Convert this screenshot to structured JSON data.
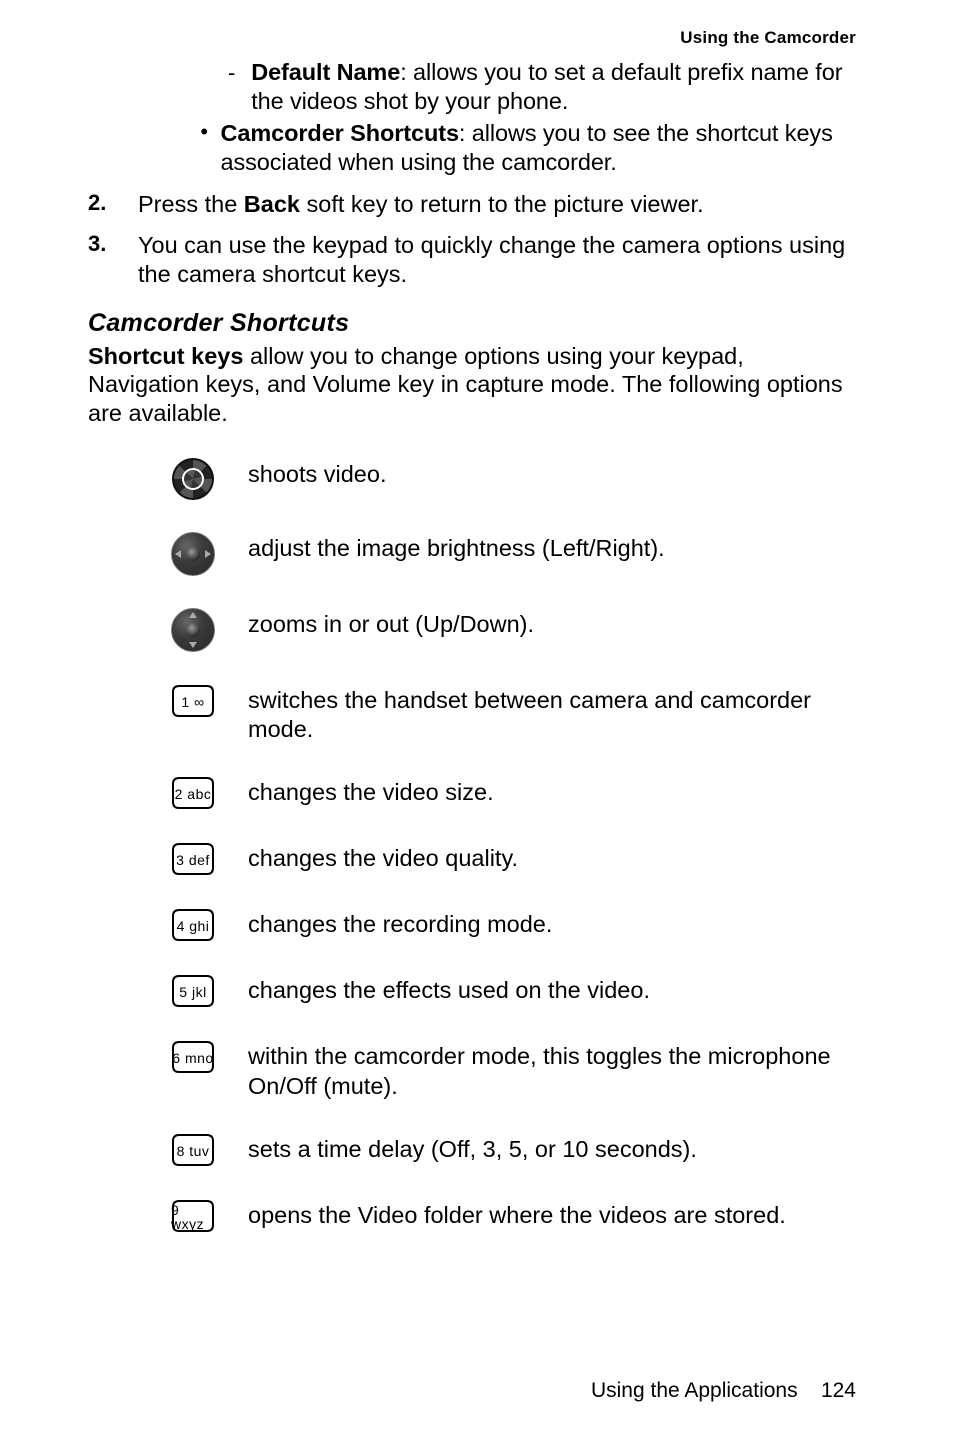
{
  "header": {
    "section_title": "Using the Camcorder"
  },
  "nested": {
    "default_name": {
      "label": "Default Name",
      "text": ": allows you to set a default prefix name for the videos shot by your phone."
    },
    "camcorder_shortcuts": {
      "label": "Camcorder Shortcuts",
      "text": ": allows you to see the shortcut keys associated when using the camcorder."
    }
  },
  "steps": {
    "s2": {
      "num": "2.",
      "pre": "Press the ",
      "bold": "Back",
      "post": " soft key to return to the picture viewer."
    },
    "s3": {
      "num": "3.",
      "text": "You can use the keypad to quickly change the camera options using the camera shortcut keys."
    }
  },
  "heading": "Camcorder Shortcuts",
  "intro": {
    "bold": "Shortcut keys",
    "rest": " allow you to change options using your keypad, Navigation keys, and Volume key in capture mode. The following options are available."
  },
  "shortcuts": [
    {
      "icon": "lens",
      "label": "",
      "desc": "shoots video."
    },
    {
      "icon": "nav-lr",
      "label": "",
      "desc": "adjust the image brightness (Left/Right)."
    },
    {
      "icon": "nav-ud",
      "label": "",
      "desc": "zooms in or out (Up/Down)."
    },
    {
      "icon": "key",
      "label": "1 ∞",
      "desc": "switches the handset between camera and camcorder mode."
    },
    {
      "icon": "key",
      "label": "2 abc",
      "desc": "changes the video size."
    },
    {
      "icon": "key",
      "label": "3 def",
      "desc": "changes the video quality."
    },
    {
      "icon": "key",
      "label": "4 ghi",
      "desc": "changes the recording mode."
    },
    {
      "icon": "key",
      "label": "5 jkl",
      "desc": "changes the effects used on the video."
    },
    {
      "icon": "key",
      "label": "6 mno",
      "desc": "within the camcorder mode, this toggles the microphone On/Off (mute)."
    },
    {
      "icon": "key",
      "label": "8 tuv",
      "desc": "sets a time delay (Off, 3, 5, or 10 seconds)."
    },
    {
      "icon": "key",
      "label": "9 wxyz",
      "desc": "opens the Video folder where the videos are stored."
    }
  ],
  "footer": {
    "chapter": "Using the Applications",
    "page": "124"
  }
}
